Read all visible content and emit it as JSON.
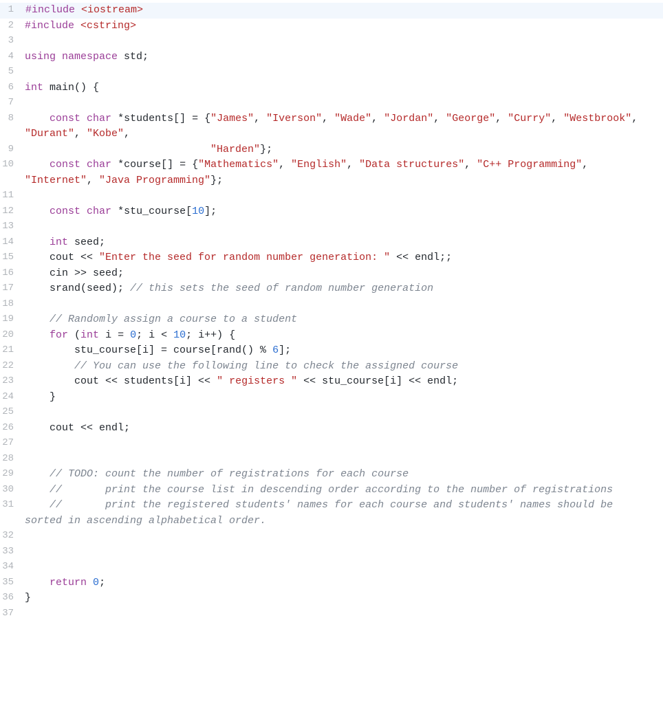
{
  "syntax": {
    "pre": {
      "color": "#9a3d97"
    },
    "inc": {
      "color": "#b52a2a"
    },
    "kw": {
      "color": "#9a3d97"
    },
    "str": {
      "color": "#b52a2a"
    },
    "num": {
      "color": "#2a6dd0"
    },
    "com": {
      "color": "#7d8590"
    },
    "plain": {
      "color": "#24292f"
    }
  },
  "highlighted_line": 1,
  "cursor_line": 1,
  "cursor_before_token_index": 0,
  "lines": [
    {
      "n": 1,
      "tokens": [
        [
          "pre",
          "#include"
        ],
        [
          "plain",
          " "
        ],
        [
          "inc",
          "<iostream>"
        ]
      ]
    },
    {
      "n": 2,
      "tokens": [
        [
          "pre",
          "#include"
        ],
        [
          "plain",
          " "
        ],
        [
          "inc",
          "<cstring>"
        ]
      ]
    },
    {
      "n": 3,
      "tokens": []
    },
    {
      "n": 4,
      "tokens": [
        [
          "kw",
          "using"
        ],
        [
          "plain",
          " "
        ],
        [
          "kw",
          "namespace"
        ],
        [
          "plain",
          " std;"
        ]
      ]
    },
    {
      "n": 5,
      "tokens": []
    },
    {
      "n": 6,
      "tokens": [
        [
          "kw",
          "int"
        ],
        [
          "plain",
          " main() {"
        ]
      ]
    },
    {
      "n": 7,
      "tokens": []
    },
    {
      "n": 8,
      "tokens": [
        [
          "plain",
          "    "
        ],
        [
          "kw",
          "const"
        ],
        [
          "plain",
          " "
        ],
        [
          "kw",
          "char"
        ],
        [
          "plain",
          " *students[] = {"
        ],
        [
          "str",
          "\"James\""
        ],
        [
          "plain",
          ", "
        ],
        [
          "str",
          "\"Iverson\""
        ],
        [
          "plain",
          ", "
        ],
        [
          "str",
          "\"Wade\""
        ],
        [
          "plain",
          ", "
        ],
        [
          "str",
          "\"Jordan\""
        ],
        [
          "plain",
          ", "
        ],
        [
          "str",
          "\"George\""
        ],
        [
          "plain",
          ", "
        ],
        [
          "str",
          "\"Curry\""
        ],
        [
          "plain",
          ", "
        ],
        [
          "str",
          "\"Westbrook\""
        ],
        [
          "plain",
          ", "
        ],
        [
          "str",
          "\"Durant\""
        ],
        [
          "plain",
          ", "
        ],
        [
          "str",
          "\"Kobe\""
        ],
        [
          "plain",
          ","
        ]
      ]
    },
    {
      "n": 9,
      "tokens": [
        [
          "plain",
          "                              "
        ],
        [
          "str",
          "\"Harden\""
        ],
        [
          "plain",
          "};"
        ]
      ]
    },
    {
      "n": 10,
      "tokens": [
        [
          "plain",
          "    "
        ],
        [
          "kw",
          "const"
        ],
        [
          "plain",
          " "
        ],
        [
          "kw",
          "char"
        ],
        [
          "plain",
          " *course[] = {"
        ],
        [
          "str",
          "\"Mathematics\""
        ],
        [
          "plain",
          ", "
        ],
        [
          "str",
          "\"English\""
        ],
        [
          "plain",
          ", "
        ],
        [
          "str",
          "\"Data structures\""
        ],
        [
          "plain",
          ", "
        ],
        [
          "str",
          "\"C++ Programming\""
        ],
        [
          "plain",
          ", "
        ],
        [
          "str",
          "\"Internet\""
        ],
        [
          "plain",
          ", "
        ],
        [
          "str",
          "\"Java Programming\""
        ],
        [
          "plain",
          "};"
        ]
      ]
    },
    {
      "n": 11,
      "tokens": []
    },
    {
      "n": 12,
      "tokens": [
        [
          "plain",
          "    "
        ],
        [
          "kw",
          "const"
        ],
        [
          "plain",
          " "
        ],
        [
          "kw",
          "char"
        ],
        [
          "plain",
          " *stu_course["
        ],
        [
          "num",
          "10"
        ],
        [
          "plain",
          "];"
        ]
      ]
    },
    {
      "n": 13,
      "tokens": []
    },
    {
      "n": 14,
      "tokens": [
        [
          "plain",
          "    "
        ],
        [
          "kw",
          "int"
        ],
        [
          "plain",
          " seed;"
        ]
      ]
    },
    {
      "n": 15,
      "tokens": [
        [
          "plain",
          "    cout << "
        ],
        [
          "str",
          "\"Enter the seed for random number generation: \""
        ],
        [
          "plain",
          " << endl;;"
        ]
      ]
    },
    {
      "n": 16,
      "tokens": [
        [
          "plain",
          "    cin >> seed;"
        ]
      ]
    },
    {
      "n": 17,
      "tokens": [
        [
          "plain",
          "    srand(seed); "
        ],
        [
          "com",
          "// this sets the seed of random number generation"
        ]
      ]
    },
    {
      "n": 18,
      "tokens": []
    },
    {
      "n": 19,
      "tokens": [
        [
          "plain",
          "    "
        ],
        [
          "com",
          "// Randomly assign a course to a student"
        ]
      ]
    },
    {
      "n": 20,
      "tokens": [
        [
          "plain",
          "    "
        ],
        [
          "kw",
          "for"
        ],
        [
          "plain",
          " ("
        ],
        [
          "kw",
          "int"
        ],
        [
          "plain",
          " i = "
        ],
        [
          "num",
          "0"
        ],
        [
          "plain",
          "; i < "
        ],
        [
          "num",
          "10"
        ],
        [
          "plain",
          "; i++) {"
        ]
      ]
    },
    {
      "n": 21,
      "tokens": [
        [
          "plain",
          "        stu_course[i] = course[rand() % "
        ],
        [
          "num",
          "6"
        ],
        [
          "plain",
          "];"
        ]
      ]
    },
    {
      "n": 22,
      "tokens": [
        [
          "plain",
          "        "
        ],
        [
          "com",
          "// You can use the following line to check the assigned course"
        ]
      ]
    },
    {
      "n": 23,
      "tokens": [
        [
          "plain",
          "        cout << students[i] << "
        ],
        [
          "str",
          "\" registers \""
        ],
        [
          "plain",
          " << stu_course[i] << endl;"
        ]
      ]
    },
    {
      "n": 24,
      "tokens": [
        [
          "plain",
          "    }"
        ]
      ]
    },
    {
      "n": 25,
      "tokens": []
    },
    {
      "n": 26,
      "tokens": [
        [
          "plain",
          "    cout << endl;"
        ]
      ]
    },
    {
      "n": 27,
      "tokens": []
    },
    {
      "n": 28,
      "tokens": []
    },
    {
      "n": 29,
      "tokens": [
        [
          "plain",
          "    "
        ],
        [
          "com",
          "// TODO: count the number of registrations for each course"
        ]
      ]
    },
    {
      "n": 30,
      "tokens": [
        [
          "plain",
          "    "
        ],
        [
          "com",
          "//       print the course list in descending order according to the number of registrations"
        ]
      ]
    },
    {
      "n": 31,
      "tokens": [
        [
          "plain",
          "    "
        ],
        [
          "com",
          "//       print the registered students' names for each course and students' names should be sorted in ascending alphabetical order."
        ]
      ]
    },
    {
      "n": 32,
      "tokens": []
    },
    {
      "n": 33,
      "tokens": []
    },
    {
      "n": 34,
      "tokens": []
    },
    {
      "n": 35,
      "tokens": [
        [
          "plain",
          "    "
        ],
        [
          "kw",
          "return"
        ],
        [
          "plain",
          " "
        ],
        [
          "num",
          "0"
        ],
        [
          "plain",
          ";"
        ]
      ]
    },
    {
      "n": 36,
      "tokens": [
        [
          "plain",
          "}"
        ]
      ]
    },
    {
      "n": 37,
      "tokens": []
    }
  ]
}
